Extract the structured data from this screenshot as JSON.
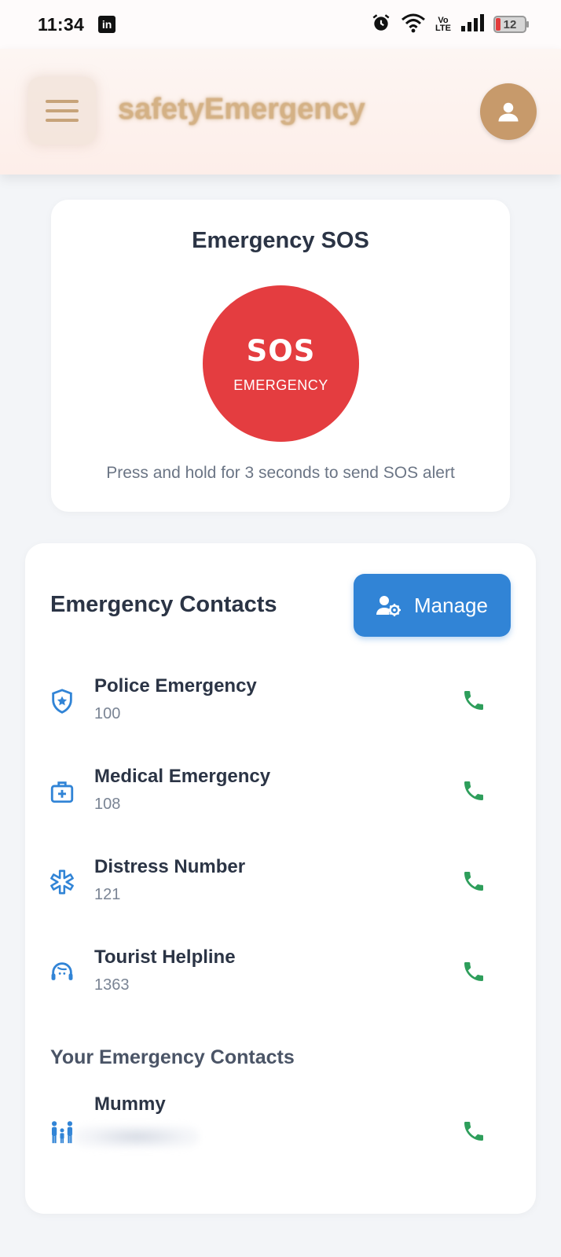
{
  "status_bar": {
    "time": "11:34",
    "app_notification": "in",
    "volte": "Vo\nLTE",
    "battery": "12",
    "battery_color": "#e23d3d"
  },
  "header": {
    "title": "safetyEmergency",
    "menu_icon": "hamburger-menu-icon",
    "profile_icon": "user-avatar-icon",
    "accent_color": "#c79a6b"
  },
  "sos": {
    "title": "Emergency SOS",
    "button_label": "SOS",
    "button_sublabel": "EMERGENCY",
    "hint": "Press and hold for 3 seconds to send SOS alert",
    "button_color": "#e43d40"
  },
  "contacts": {
    "title": "Emergency Contacts",
    "manage_label": "Manage",
    "manage_color": "#3184d6",
    "items": [
      {
        "name": "Police Emergency",
        "number": "100",
        "icon": "police-shield-icon"
      },
      {
        "name": "Medical Emergency",
        "number": "108",
        "icon": "medical-kit-icon"
      },
      {
        "name": "Distress Number",
        "number": "121",
        "icon": "asterisk-icon"
      },
      {
        "name": "Tourist Helpline",
        "number": "1363",
        "icon": "support-agent-icon"
      }
    ],
    "call_color": "#2e9e5b"
  },
  "your_contacts": {
    "title": "Your Emergency Contacts",
    "items": [
      {
        "name": "Mummy",
        "icon": "family-icon"
      }
    ]
  }
}
